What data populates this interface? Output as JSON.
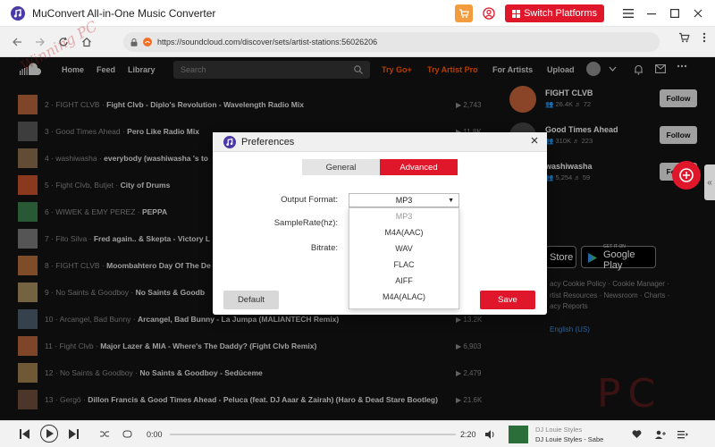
{
  "app": {
    "title": "MuConvert All-in-One Music Converter",
    "switch_label": "Switch Platforms"
  },
  "browser": {
    "url": "https://soundcloud.com/discover/sets/artist-stations:56026206"
  },
  "soundcloud": {
    "nav": {
      "home": "Home",
      "feed": "Feed",
      "library": "Library",
      "search_placeholder": "Search",
      "try_go": "Try Go+",
      "try_artist": "Try Artist Pro",
      "for_artists": "For Artists",
      "upload": "Upload"
    },
    "tracks": [
      {
        "num": "2",
        "artist": "FIGHT CLVB",
        "title": "Fight Clvb - Diplo's Revolution - Wavelength Radio Mix",
        "plays": "2,743",
        "color": "#b0603a"
      },
      {
        "num": "3",
        "artist": "Good Times Ahead",
        "title": "Pero Like Radio Mix",
        "plays": "11.8K",
        "color": "#555555"
      },
      {
        "num": "4",
        "artist": "washiwasha",
        "title": "everybody (washiwasha 's to",
        "plays": "",
        "color": "#8a6a4a"
      },
      {
        "num": "5",
        "artist": "Fight Clvb, Butjet",
        "title": "City of Drums",
        "plays": "",
        "color": "#c0502a"
      },
      {
        "num": "6",
        "artist": "WIWEK & EMY PEREZ",
        "title": "PEPPA",
        "plays": "",
        "color": "#3a7a4a"
      },
      {
        "num": "7",
        "artist": "Fito Silva",
        "title": "Fred again.. & Skepta - Victory L",
        "plays": "",
        "color": "#777777"
      },
      {
        "num": "8",
        "artist": "FIGHT CLVB",
        "title": "Moombahtero Day Of The De",
        "plays": "",
        "color": "#b06a3a"
      },
      {
        "num": "9",
        "artist": "No Saints & Goodboy",
        "title": "No Saints & Goodb",
        "plays": "",
        "color": "#a08a5a"
      },
      {
        "num": "10",
        "artist": "Arcangel, Bad Bunny",
        "title": "Arcangel, Bad Bunny - La Jumpa (MALIANTECH Remix)",
        "plays": "13.2K",
        "color": "#4a5a6a"
      },
      {
        "num": "11",
        "artist": "Fight Clvb",
        "title": "Major Lazer & MIA - Where's The Daddy? (Fight Clvb Remix)",
        "plays": "6,903",
        "color": "#b0603a"
      },
      {
        "num": "12",
        "artist": "No Saints & Goodboy",
        "title": "No Saints & Goodboy - Sedúceme",
        "plays": "2,479",
        "color": "#9a7a4a"
      },
      {
        "num": "13",
        "artist": "Gergö",
        "title": "Dillon Francis & Good Times Ahead - Peluca (feat. DJ Aaar & Zairah) (Haro & Dead Stare Bootleg)",
        "plays": "21.6K",
        "color": "#6a4a3a"
      }
    ],
    "artists": [
      {
        "name": "FIGHT CLVB",
        "followers": "26.4K",
        "tracks": "72",
        "follow": "Follow",
        "color": "#c0603a"
      },
      {
        "name": "Good Times Ahead",
        "followers": "310K",
        "tracks": "223",
        "follow": "Follow",
        "color": "#444444"
      },
      {
        "name": "washiwasha",
        "followers": "5,254",
        "tracks": "59",
        "follow": "Follow",
        "color": "#6a6a6a"
      }
    ],
    "app_store": {
      "small": "",
      "big": "Store"
    },
    "google_play": {
      "small": "GET IT ON",
      "big": "Google Play"
    },
    "footer_lines": [
      "acy Cookie Policy · Cookie Manager ·",
      "rtist Resources · Newsroom · Charts ·",
      "acy Reports"
    ],
    "language": "English (US)"
  },
  "watermark": {
    "left": "Winning PC",
    "right": "PC"
  },
  "dialog": {
    "title": "Preferences",
    "tab_general": "General",
    "tab_advanced": "Advanced",
    "output_format_label": "Output Format:",
    "samplerate_label": "SampleRate(hz):",
    "bitrate_label": "Bitrate:",
    "output_format_value": "MP3",
    "format_options": [
      "MP3",
      "M4A(AAC)",
      "WAV",
      "FLAC",
      "AIFF",
      "M4A(ALAC)"
    ],
    "default_label": "Default",
    "save_label": "Save"
  },
  "player": {
    "elapsed": "0:00",
    "duration": "2:20",
    "np_artist": "DJ Louie Styles",
    "np_title": "DJ Louie Styles - Sabe"
  }
}
